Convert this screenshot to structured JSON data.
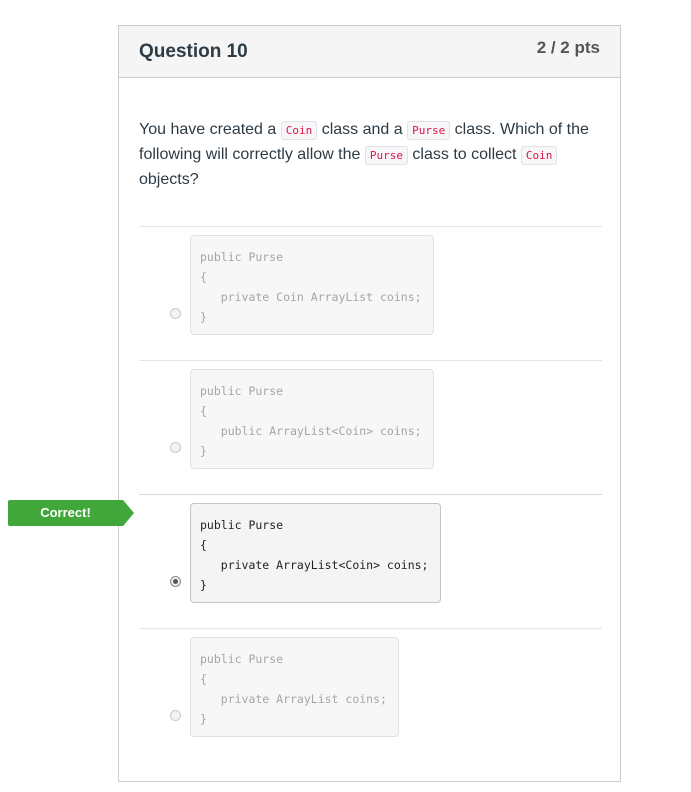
{
  "question": {
    "title": "Question 10",
    "points": "2 / 2 pts",
    "text": {
      "p1": "You have created a ",
      "c1": "Coin",
      "p2": " class and a ",
      "c2": "Purse",
      "p3": " class. Which of the following will correctly allow the ",
      "c3": "Purse",
      "p4": " class to collect ",
      "c4": "Coin",
      "p5": " objects?"
    }
  },
  "flag": {
    "label": "Correct!",
    "color": "#41a73b"
  },
  "answers": [
    {
      "lines": [
        "public Purse",
        "{",
        "   private Coin ArrayList coins;",
        "}"
      ],
      "selected": false
    },
    {
      "lines": [
        "public Purse",
        "{",
        "   public ArrayList<Coin> coins;",
        "}"
      ],
      "selected": false
    },
    {
      "lines": [
        "public Purse",
        "{",
        "   private ArrayList<Coin> coins;",
        "}"
      ],
      "selected": true
    },
    {
      "lines": [
        "public Purse",
        "{",
        "   private ArrayList coins;",
        "}"
      ],
      "selected": false
    }
  ]
}
